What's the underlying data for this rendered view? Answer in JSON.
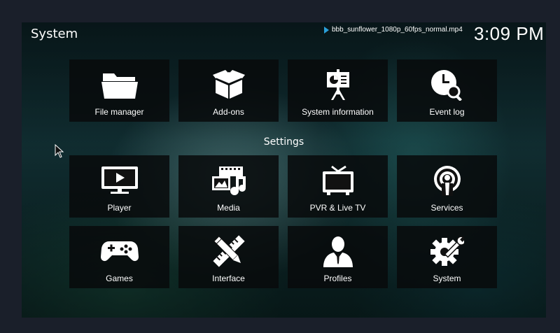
{
  "header": {
    "title": "System",
    "now_playing": "bbb_sunflower_1080p_60fps_normal.mp4",
    "clock": "3:09 PM"
  },
  "top_tiles": [
    {
      "label": "File manager",
      "icon": "folder-icon"
    },
    {
      "label": "Add-ons",
      "icon": "box-icon"
    },
    {
      "label": "System information",
      "icon": "presentation-icon"
    },
    {
      "label": "Event log",
      "icon": "clock-search-icon"
    }
  ],
  "settings": {
    "title": "Settings",
    "tiles": [
      {
        "label": "Player",
        "icon": "monitor-play-icon"
      },
      {
        "label": "Media",
        "icon": "media-icon"
      },
      {
        "label": "PVR & Live TV",
        "icon": "tv-icon"
      },
      {
        "label": "Services",
        "icon": "podcast-icon"
      },
      {
        "label": "Games",
        "icon": "gamepad-icon"
      },
      {
        "label": "Interface",
        "icon": "pencil-ruler-icon"
      },
      {
        "label": "Profiles",
        "icon": "user-icon"
      },
      {
        "label": "System",
        "icon": "gear-wrench-icon"
      }
    ]
  },
  "colors": {
    "accent": "#2a9fd8",
    "tile_bg": "#080a0c"
  }
}
